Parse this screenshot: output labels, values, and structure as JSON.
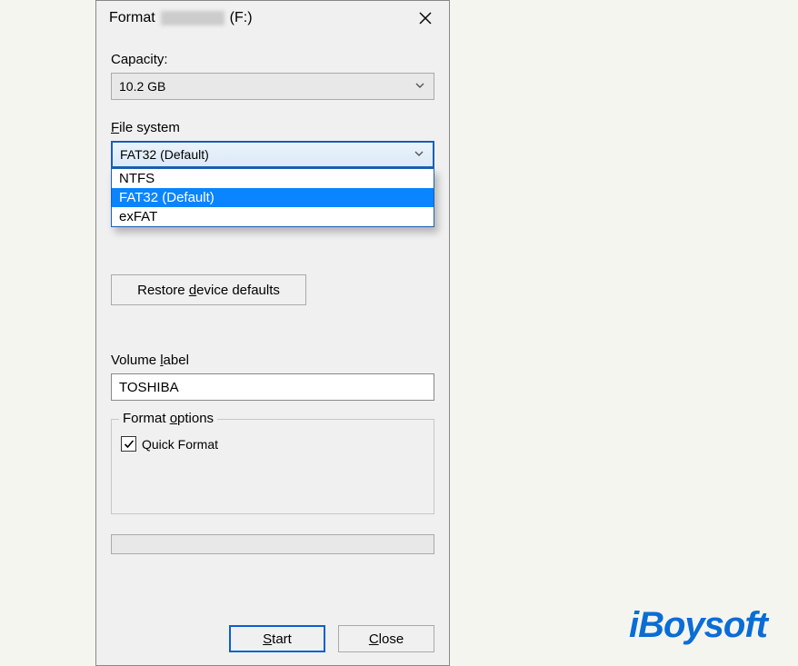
{
  "title": {
    "prefix": "Format",
    "drive": "(F:)"
  },
  "capacity": {
    "label": "Capacity:",
    "value": "10.2 GB"
  },
  "filesystem": {
    "label_pre": "F",
    "label_rest": "ile system",
    "value": "FAT32 (Default)",
    "options": [
      "NTFS",
      "FAT32 (Default)",
      "exFAT"
    ],
    "selected_index": 1
  },
  "restore_label_pre": "Restore ",
  "restore_label_u": "d",
  "restore_label_post": "evice defaults",
  "volume": {
    "label_pre": "Volume ",
    "label_u": "l",
    "label_post": "abel",
    "value": "TOSHIBA"
  },
  "format_options": {
    "legend_pre": "Format ",
    "legend_u": "o",
    "legend_post": "ptions",
    "quick_label": "Quick Format",
    "quick_checked": true
  },
  "buttons": {
    "start_u": "S",
    "start_rest": "tart",
    "close_u": "C",
    "close_rest": "lose"
  },
  "watermark": "iBoysoft"
}
